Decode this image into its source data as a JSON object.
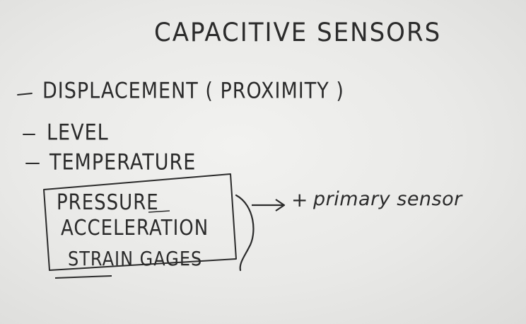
{
  "whiteboard": {
    "title": "CAPACITIVE SENSORS",
    "items": [
      "DISPLACEMENT ( PROXIMITY )",
      "LEVEL",
      "TEMPERATURE"
    ],
    "boxed_items": [
      "PRESSURE",
      "ACCELERATION",
      "STRAIN GAGES"
    ],
    "annotation_symbol": "+",
    "annotation": "primary sensor",
    "ink_color": "#2b2b2b",
    "board_color": "#ececea"
  }
}
